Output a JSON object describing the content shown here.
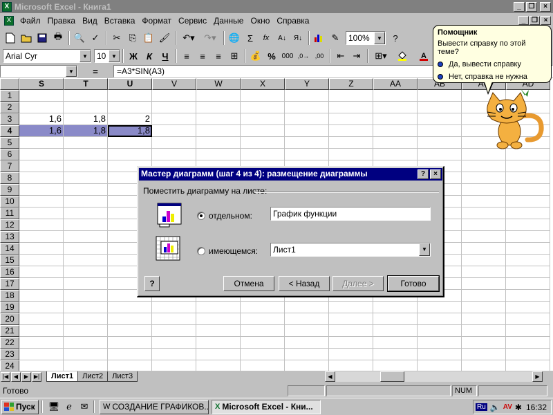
{
  "window": {
    "title": "Microsoft Excel - Книга1",
    "app_icon_letter": "X"
  },
  "menu": [
    "Файл",
    "Правка",
    "Вид",
    "Вставка",
    "Формат",
    "Сервис",
    "Данные",
    "Окно",
    "Справка"
  ],
  "toolbar": {
    "zoom": "100%",
    "font_name": "Arial Cyr",
    "font_size": "10",
    "bold": "Ж",
    "italic": "К",
    "underline": "Ч",
    "sum": "Σ",
    "fx": "fx",
    "percent": "%",
    "thousands": "000"
  },
  "formula_bar": {
    "name_box": "",
    "equals": "=",
    "formula": "=A3*SIN(A3)"
  },
  "grid": {
    "columns": [
      "S",
      "T",
      "U",
      "V",
      "W",
      "X",
      "Y",
      "Z",
      "AA",
      "AB",
      "AC",
      "AD"
    ],
    "selected_columns": [
      "S",
      "T",
      "U"
    ],
    "selected_row": 4,
    "rows": [
      {
        "n": "1",
        "cells": [
          "",
          "",
          ""
        ]
      },
      {
        "n": "2",
        "cells": [
          "",
          "",
          ""
        ]
      },
      {
        "n": "3",
        "cells": [
          "1,6",
          "1,8",
          "2"
        ]
      },
      {
        "n": "4",
        "cells": [
          "1,6",
          "1,8",
          "1,8"
        ]
      },
      {
        "n": "5",
        "cells": [
          "",
          "",
          ""
        ]
      },
      {
        "n": "6",
        "cells": [
          "",
          "",
          ""
        ]
      },
      {
        "n": "7",
        "cells": [
          "",
          "",
          ""
        ]
      },
      {
        "n": "8",
        "cells": [
          "",
          "",
          ""
        ]
      },
      {
        "n": "9",
        "cells": [
          "",
          "",
          ""
        ]
      },
      {
        "n": "10",
        "cells": [
          "",
          "",
          ""
        ]
      },
      {
        "n": "11",
        "cells": [
          "",
          "",
          ""
        ]
      },
      {
        "n": "12",
        "cells": [
          "",
          "",
          ""
        ]
      },
      {
        "n": "13",
        "cells": [
          "",
          "",
          ""
        ]
      },
      {
        "n": "14",
        "cells": [
          "",
          "",
          ""
        ]
      },
      {
        "n": "15",
        "cells": [
          "",
          "",
          ""
        ]
      },
      {
        "n": "16",
        "cells": [
          "",
          "",
          ""
        ]
      },
      {
        "n": "17",
        "cells": [
          "",
          "",
          ""
        ]
      },
      {
        "n": "18",
        "cells": [
          "",
          "",
          ""
        ]
      },
      {
        "n": "19",
        "cells": [
          "",
          "",
          ""
        ]
      },
      {
        "n": "20",
        "cells": [
          "",
          "",
          ""
        ]
      },
      {
        "n": "21",
        "cells": [
          "",
          "",
          ""
        ]
      },
      {
        "n": "22",
        "cells": [
          "",
          "",
          ""
        ]
      },
      {
        "n": "23",
        "cells": [
          "",
          "",
          ""
        ]
      },
      {
        "n": "24",
        "cells": [
          "",
          "",
          ""
        ]
      }
    ]
  },
  "sheets": [
    "Лист1",
    "Лист2",
    "Лист3"
  ],
  "active_sheet": "Лист1",
  "status": {
    "text": "Готово",
    "num": "NUM"
  },
  "assistant": {
    "title": "Помощник",
    "question": "Вывести справку по этой теме?",
    "options": [
      "Да, вывести справку",
      "Нет, справка не нужна"
    ]
  },
  "dialog": {
    "title": "Мастер диаграмм (шаг 4 из 4): размещение диаграммы",
    "help_btn": "?",
    "close_btn": "×",
    "caption": "Поместить диаграмму на листе:",
    "option_separate": "отдельном:",
    "option_existing": "имеющемся:",
    "separate_value": "График функции",
    "existing_value": "Лист1",
    "selected_option": "separate",
    "buttons": {
      "cancel": "Отмена",
      "back": "< Назад",
      "next": "Далее >",
      "finish": "Готово"
    }
  },
  "taskbar": {
    "start": "Пуск",
    "tasks": [
      {
        "label": "СОЗДАНИЕ ГРАФИКОВ...",
        "pressed": false
      },
      {
        "label": "Microsoft Excel - Кни...",
        "pressed": true
      }
    ],
    "lang": "Ru",
    "clock": "16:32"
  },
  "colors": {
    "title_inactive": "#808080",
    "dialog_title": "#000080",
    "selection": "#8a8ac8",
    "balloon": "#ffffe1"
  }
}
